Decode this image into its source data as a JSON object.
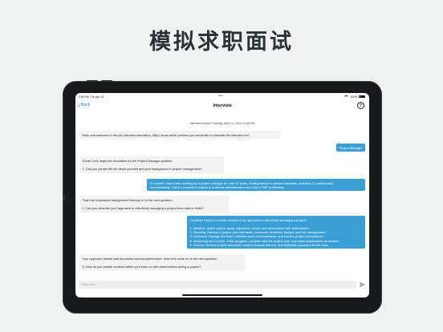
{
  "headline": "模拟求职面试",
  "status_bar": {
    "time": "2:54 PM",
    "date": "Thu Apr 13",
    "battery": "100%"
  },
  "nav": {
    "back_label": "Back",
    "title": "Interview",
    "help_symbol": "?"
  },
  "chat": {
    "started_text": "Interview started Tuesday, April 11, 2023 12:48 PM",
    "messages": [
      {
        "role": "bot",
        "text": "Hello and welcome to the job-interview simulation. May I know which position you would like to simulate the interview for?"
      },
      {
        "role": "user",
        "text": "Project Manager"
      },
      {
        "role": "bot",
        "text": "Great! Let's begin the simulation for the Project Manager position.\n\n1. Can you please tell me about yourself and your background in project management?"
      },
      {
        "role": "user",
        "text": "Of course! I have been working as a project manager for over 10 years, leading teams in various industries, including IT, construction,\nand marketing. I have a bachelor's degree in business administration and hold a PMP certification."
      },
      {
        "role": "bot",
        "text": "That's an impressive background! Moving on to the next question.\n\n2. Can you describe your approach to effectively managing a project from start to finish?"
      },
      {
        "role": "user",
        "text": "Certainly! Here's a concise version of my approach to effectively managing a project:\n\n1. Initiation: Define project goals, objectives, scope, and deliverables with stakeholders.\n2. Planning: Develop a project plan with tasks, resources, timelines, budget, and risk management.\n3. Execution: Manage the team, maintain open communication, and monitor project performance.\n4. Monitoring and Control: Track progress, compare with the project plan, and make adjustments as needed.\n5. Closure: Review project outcomes, conduct lessons learned, and celebrate success with the team."
      },
      {
        "role": "bot",
        "text": "Your approach seems well-structured and comprehensive. Now let's move on to the next question.\n\n3. How do you handle conflicts within your team or with stakeholders during a project?"
      }
    ]
  },
  "composer": {
    "placeholder": "Write here..."
  },
  "colors": {
    "accent": "#2a7ec0",
    "user_bubble": "#3a9fd5",
    "bot_bubble": "#f2f2f2"
  }
}
